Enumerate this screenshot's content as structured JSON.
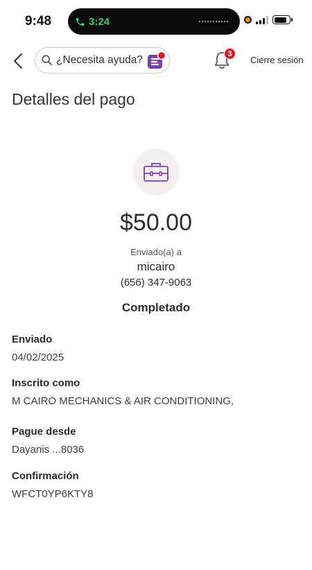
{
  "status_bar": {
    "time": "9:48",
    "call_timer": "3:24"
  },
  "header": {
    "search_placeholder": "¿Necesita ayuda?",
    "notification_count": "3",
    "signout_label": "Cierre sesión"
  },
  "page": {
    "title": "Detalles del pago"
  },
  "payment": {
    "amount": "$50.00",
    "sent_to_label": "Enviado(a) a",
    "recipient": "micairo",
    "phone": "(656) 347-9063",
    "status": "Completado"
  },
  "details": [
    {
      "label": "Enviado",
      "value": "04/02/2025"
    },
    {
      "label": "Inscrito como",
      "value": "M CAIRO MECHANICS & AIR CONDITIONING,"
    },
    {
      "label": "Pague desde",
      "value": "Dayanis ...8036"
    },
    {
      "label": "Confirmación",
      "value": "WFCT0YP6KTY8"
    }
  ],
  "colors": {
    "accent_purple": "#7b3fb5",
    "brand_red": "#d71e28",
    "call_green": "#35d36b"
  }
}
